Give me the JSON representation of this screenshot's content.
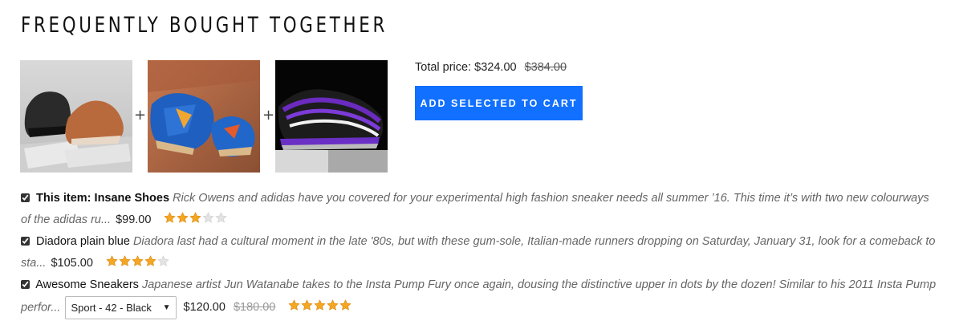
{
  "title": "FREQUENTLY BOUGHT TOGETHER",
  "products_row": {
    "plus_sign": "+"
  },
  "summary": {
    "total_label": "Total price:",
    "total_price": "$324.00",
    "original_total": "$384.00",
    "add_button_label": "ADD SELECTED TO CART"
  },
  "items": [
    {
      "name": "This item: Insane Shoes",
      "description": "Rick Owens and adidas have you covered for your experimental high fashion sneaker needs all summer ’16. This time it’s with two new colourways of the adidas ru...",
      "price": "$99.00",
      "rating": 3,
      "max_rating": 5,
      "checked": true
    },
    {
      "name": "Diadora plain blue",
      "description": "Diadora last had a cultural moment in the late '80s, but with these gum-sole, Italian-made runners dropping on Saturday, January 31, look for a comeback to sta...",
      "price": "$105.00",
      "rating": 4,
      "max_rating": 5,
      "checked": true
    },
    {
      "name": "Awesome Sneakers",
      "description": "Japanese artist Jun Watanabe takes to the Insta Pump Fury once again, dousing the distinctive upper in dots by the dozen! Similar to his 2011 Insta Pump perfor...",
      "variant_selected": "Sport - 42 - Black",
      "price": "$120.00",
      "original_price": "$180.00",
      "rating": 5,
      "max_rating": 5,
      "checked": true
    }
  ],
  "colors": {
    "button": "#1170ff",
    "star_filled": "#f5a623",
    "star_empty": "#e3e3e3"
  }
}
